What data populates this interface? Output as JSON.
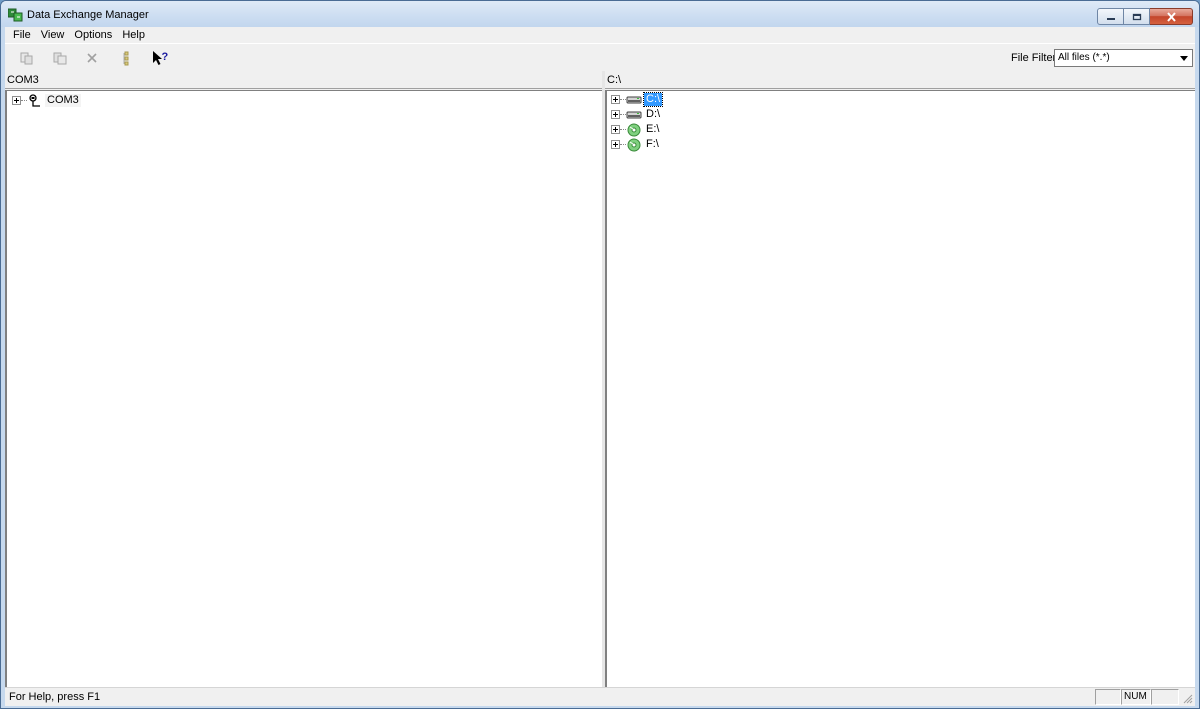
{
  "window": {
    "title": "Data Exchange Manager",
    "icons": [
      "app-icon",
      "minimize-icon",
      "maximize-icon",
      "close-icon"
    ]
  },
  "menubar": {
    "items": [
      {
        "label": "File"
      },
      {
        "label": "View"
      },
      {
        "label": "Options"
      },
      {
        "label": "Help"
      }
    ]
  },
  "toolbar": {
    "buttons": [
      {
        "icon": "copy-to-icon",
        "enabled": false
      },
      {
        "icon": "copy-from-icon",
        "enabled": false
      },
      {
        "icon": "delete-icon",
        "enabled": false
      },
      {
        "icon": "properties-icon",
        "enabled": false
      },
      {
        "icon": "context-help-icon",
        "enabled": true
      }
    ],
    "file_filter_label": "File Filter",
    "file_filter_value": "All files (*.*)"
  },
  "left_pane": {
    "header": "COM3",
    "tree": [
      {
        "label": "COM3",
        "icon": "serial-port-icon",
        "selected": false
      }
    ]
  },
  "right_pane": {
    "header": "C:\\",
    "tree": [
      {
        "label": "C:\\",
        "icon": "hard-drive-icon",
        "selected": true
      },
      {
        "label": "D:\\",
        "icon": "hard-drive-icon",
        "selected": false
      },
      {
        "label": "E:\\",
        "icon": "cd-drive-icon",
        "selected": false
      },
      {
        "label": "F:\\",
        "icon": "cd-drive-icon",
        "selected": false
      }
    ]
  },
  "statusbar": {
    "help_text": "For Help, press F1",
    "indicators": [
      "",
      "NUM",
      ""
    ]
  },
  "colors": {
    "selection": "#3399ff",
    "window_frame": "#c6d9ee",
    "close_button": "#c4452c"
  }
}
